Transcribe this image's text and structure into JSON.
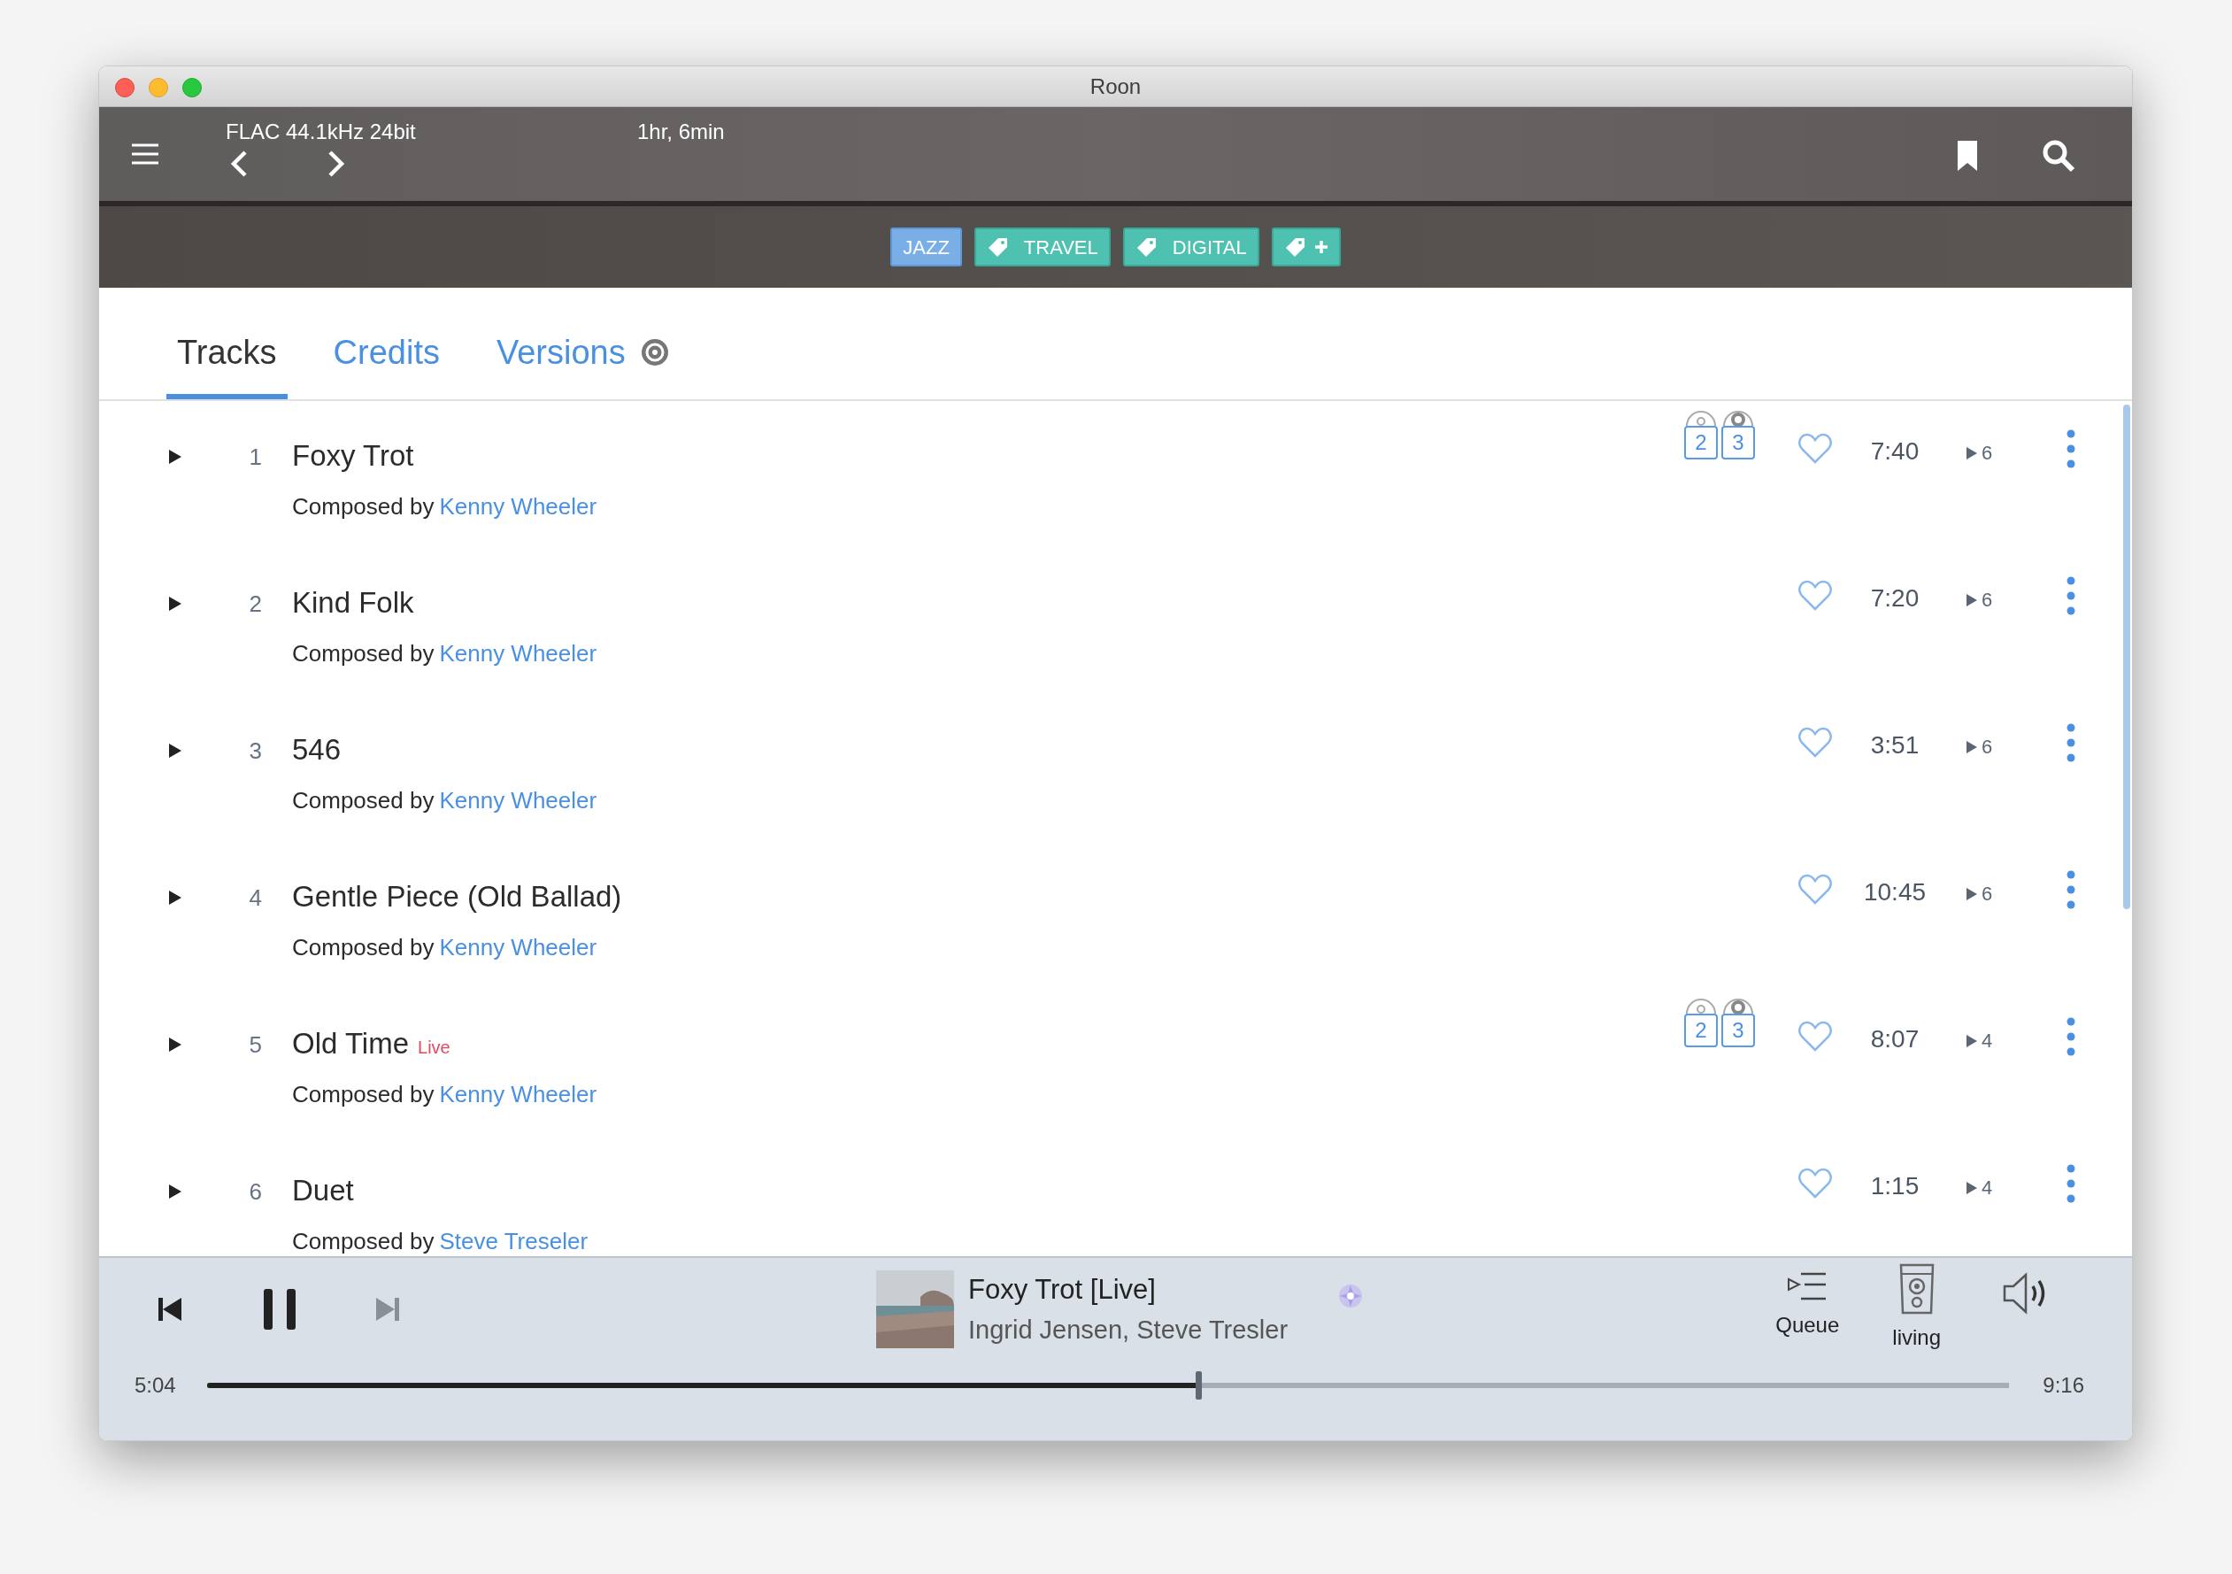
{
  "window": {
    "title": "Roon"
  },
  "header": {
    "format": "FLAC 44.1kHz 24bit",
    "duration": "1hr, 6min"
  },
  "tags": [
    {
      "kind": "genre",
      "label": "JAZZ"
    },
    {
      "kind": "tag",
      "label": "TRAVEL"
    },
    {
      "kind": "tag",
      "label": "DIGITAL"
    },
    {
      "kind": "add"
    }
  ],
  "tabs": [
    {
      "label": "Tracks",
      "selected": true
    },
    {
      "label": "Credits",
      "selected": false
    },
    {
      "label": "Versions",
      "selected": false
    }
  ],
  "tracks": [
    {
      "number": "1",
      "title": "Foxy Trot",
      "composed_by": "Composed by",
      "composer": "Kenny Wheeler",
      "versions": [
        "2",
        "3"
      ],
      "favorite": false,
      "duration": "7:40",
      "plays": "6"
    },
    {
      "number": "2",
      "title": "Kind Folk",
      "composed_by": "Composed by",
      "composer": "Kenny Wheeler",
      "favorite": false,
      "duration": "7:20",
      "plays": "6"
    },
    {
      "number": "3",
      "title": "546",
      "composed_by": "Composed by",
      "composer": "Kenny Wheeler",
      "favorite": false,
      "duration": "3:51",
      "plays": "6"
    },
    {
      "number": "4",
      "title": "Gentle Piece (Old Ballad)",
      "composed_by": "Composed by",
      "composer": "Kenny Wheeler",
      "favorite": false,
      "duration": "10:45",
      "plays": "6"
    },
    {
      "number": "5",
      "title": "Old Time",
      "badge": "Live",
      "composed_by": "Composed by",
      "composer": "Kenny Wheeler",
      "versions": [
        "2",
        "3"
      ],
      "favorite": false,
      "duration": "8:07",
      "plays": "4"
    },
    {
      "number": "6",
      "title": "Duet",
      "composed_by": "Composed by",
      "composer": "Steve Treseler",
      "favorite": false,
      "duration": "1:15",
      "plays": "4"
    }
  ],
  "player": {
    "title": "Foxy Trot [Live]",
    "artists": "Ingrid Jensen, Steve Tresler",
    "next_disabled": true,
    "queue_label": "Queue",
    "zone_label": "living",
    "elapsed": "5:04",
    "total": "9:16",
    "level": 0.55
  }
}
